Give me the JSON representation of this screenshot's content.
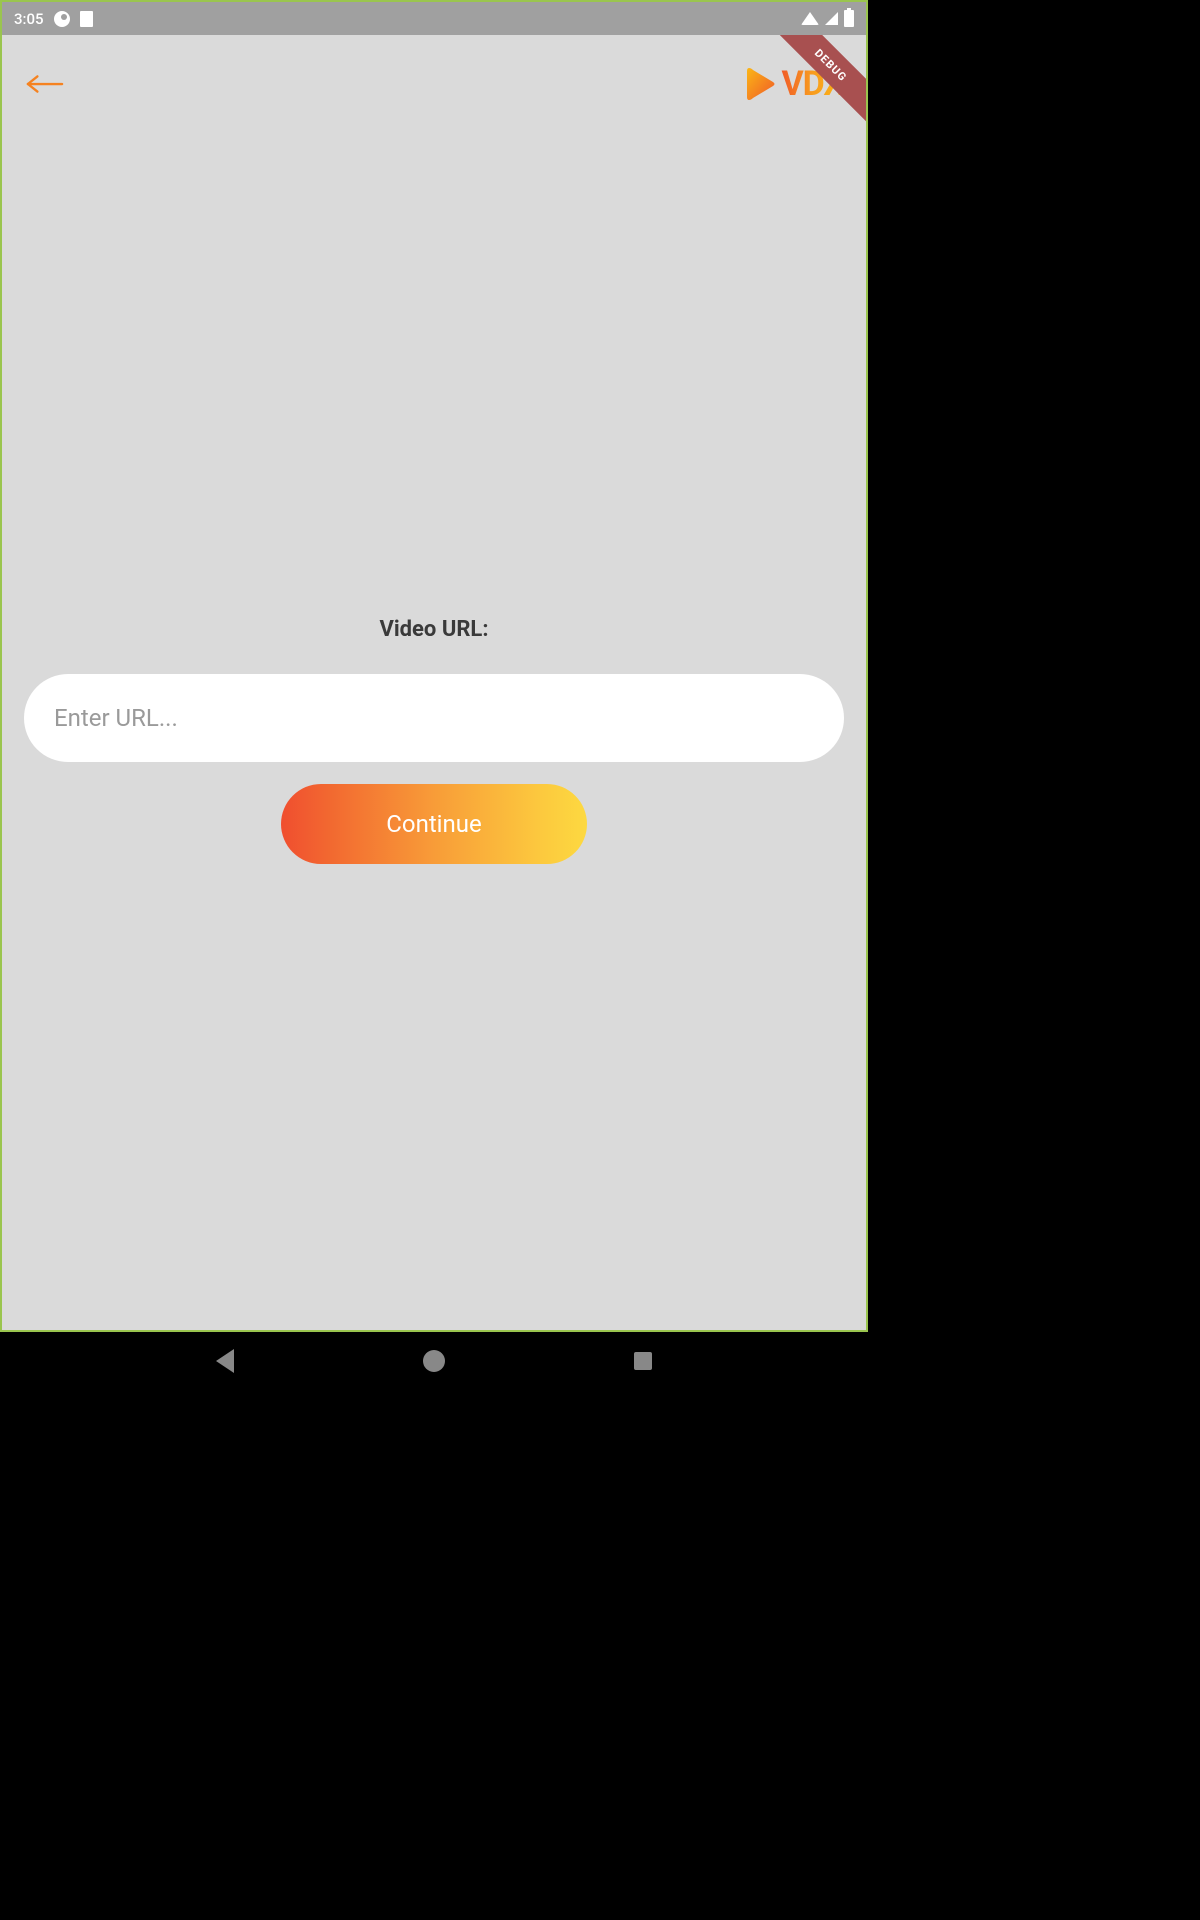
{
  "status_bar": {
    "time": "3:05"
  },
  "debug_banner": {
    "label": "DEBUG"
  },
  "logo": {
    "text": "VDX"
  },
  "form": {
    "label": "Video URL:",
    "input_placeholder": "Enter URL...",
    "input_value": "",
    "continue_label": "Continue"
  },
  "colors": {
    "accent_start": "#F04E2F",
    "accent_end": "#FDD940",
    "bg": "#DADADA"
  }
}
